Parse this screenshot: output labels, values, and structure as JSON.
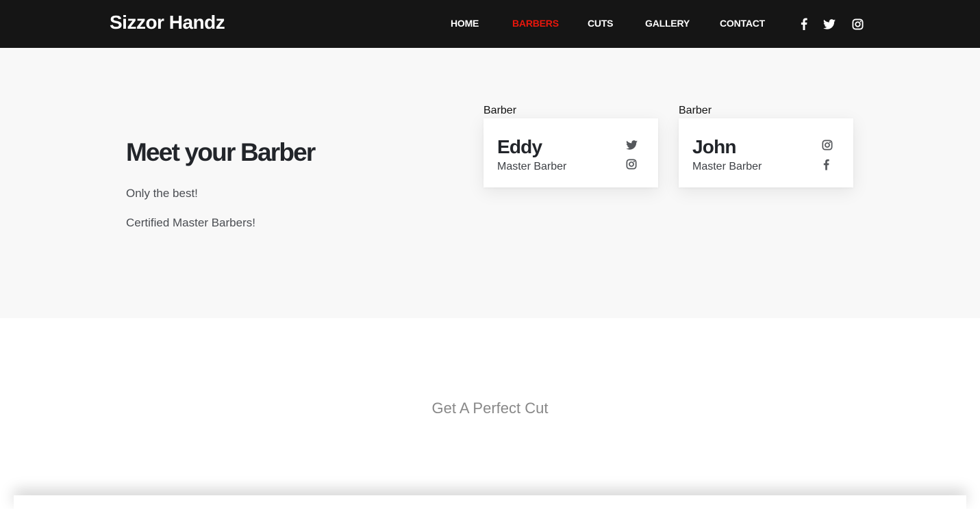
{
  "brand": {
    "name": "Sizzor Handz"
  },
  "nav": {
    "items": [
      {
        "label": "HOME",
        "active": false
      },
      {
        "label": "BARBERS",
        "active": true
      },
      {
        "label": "CUTS",
        "active": false
      },
      {
        "label": "GALLERY",
        "active": false
      },
      {
        "label": "CONTACT",
        "active": false
      }
    ],
    "social": [
      "facebook-icon",
      "twitter-icon",
      "instagram-icon"
    ]
  },
  "hero": {
    "title": "Meet your Barber",
    "lines": [
      "Only the best!",
      "Certified Master Barbers!"
    ]
  },
  "barbers": [
    {
      "caption": "Barber",
      "name": "Eddy",
      "role": "Master Barber",
      "icons": [
        "twitter-icon",
        "instagram-icon"
      ]
    },
    {
      "caption": "Barber",
      "name": "John",
      "role": "Master Barber",
      "icons": [
        "instagram-icon",
        "facebook-icon"
      ]
    }
  ],
  "cta": {
    "text": "Get A Perfect Cut"
  },
  "colors": {
    "navbar": "#151515",
    "accent": "#e8160c",
    "hero_bg": "#f8f8f8"
  }
}
